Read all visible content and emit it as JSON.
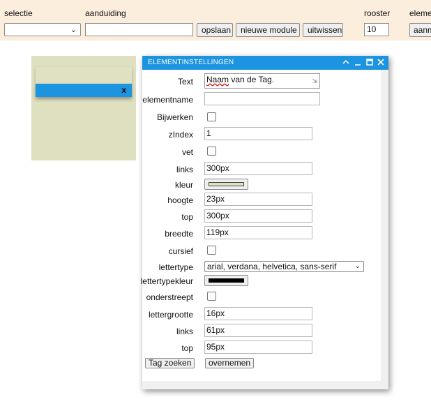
{
  "toolbar": {
    "selectie_label": "selectie",
    "aanduiding_label": "aanduiding",
    "rooster_label": "rooster",
    "element_label": "eleme",
    "selectie_value": "",
    "aanduiding_value": "",
    "opslaan_label": "opslaan",
    "nieuwe_module_label": "nieuwe module",
    "uitwissen_label": "uitwissen",
    "rooster_value": "10",
    "aanm_label": "aanm"
  },
  "tag_element": {
    "close_label": "x",
    "head_color": "#e0e1c2",
    "bar_color": "#1c94e0",
    "panel_color": "#dfe0c0"
  },
  "dialog": {
    "title": "ELEMENTINSTELLINGEN",
    "controls": {
      "collapse": "^",
      "minimize": "_",
      "maximize": "□",
      "close": "✕"
    },
    "fields": {
      "text_label": "Text",
      "text_value_a": "Naam",
      "text_value_b": " van de Tag.",
      "elementname_label": "elementname",
      "elementname_value": "",
      "bijwerken_label": "Bijwerken",
      "zindex_label": "zIndex",
      "zindex_value": "1",
      "vet_label": "vet",
      "links_label": "links",
      "links_value": "300px",
      "kleur_label": "kleur",
      "kleur_color": "#e0e1c2",
      "hoogte_label": "hoogte",
      "hoogte_value": "23px",
      "top_label": "top",
      "top_value": "300px",
      "breedte_label": "breedte",
      "breedte_value": "119px",
      "cursief_label": "cursief",
      "lettertype_label": "lettertype",
      "lettertype_value": "arial, verdana, helvetica, sans-serif",
      "lettertypekleur_label": "lettertypekleur",
      "lettertypekleur_color": "#000000",
      "onderstreept_label": "onderstreept",
      "lettergrootte_label": "lettergrootte",
      "lettergrootte_value": "16px",
      "links2_label": "links",
      "links2_value": "61px",
      "top2_label": "top",
      "top2_value": "95px"
    },
    "buttons": {
      "tag_zoeken": "Tag zoeken",
      "overnemen": "overnemen"
    },
    "accent_color": "#1c94e0"
  }
}
